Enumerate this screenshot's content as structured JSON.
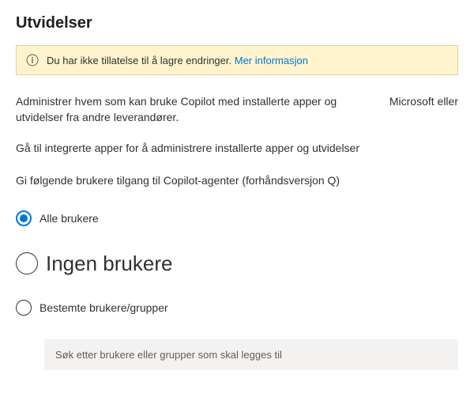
{
  "header": {
    "title": "Utvidelser"
  },
  "banner": {
    "message": "Du har ikke tillatelse til å lagre endringer. ",
    "link": "Mer informasjon"
  },
  "description": {
    "main": "Administrer hvem som kan bruke Copilot med installerte apper og utvidelser fra andre leverandører.",
    "suffix": "Microsoft eller",
    "sub": "Gå til integrerte apper for å administrere installerte apper og utvidelser",
    "section": "Gi følgende brukere tilgang til Copilot-agenter (forhåndsversjon Q)"
  },
  "radios": {
    "options": [
      {
        "label": "Alle brukere",
        "selected": true
      },
      {
        "label": "Ingen brukere",
        "selected": false
      },
      {
        "label": "Bestemte brukere/grupper",
        "selected": false
      }
    ]
  },
  "search": {
    "placeholder": "Søk etter brukere eller grupper som skal legges til"
  }
}
